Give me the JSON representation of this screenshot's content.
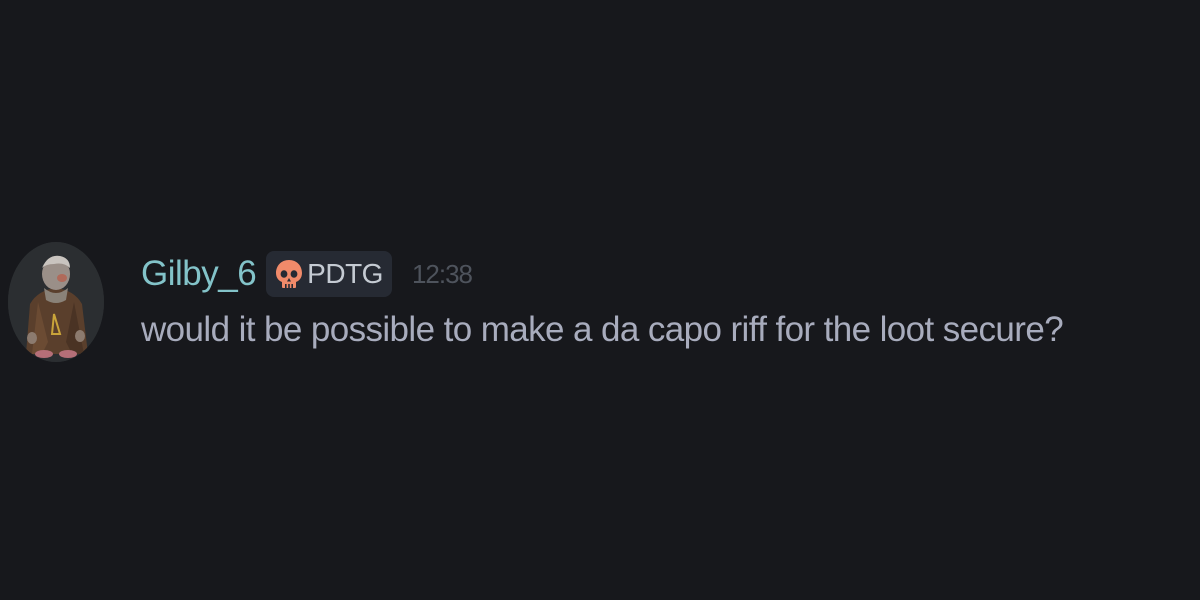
{
  "message": {
    "username": "Gilby_6",
    "tag": {
      "label": "PDTG",
      "icon": "skull-icon"
    },
    "timestamp": "12:38",
    "text": "would it be possible to make a da capo riff for the loot secure?"
  },
  "colors": {
    "background": "#17181c",
    "username": "#83c3c9",
    "tag_background": "#262a33",
    "tag_icon": "#f08a6a",
    "text": "#a8acbd",
    "timestamp": "#4e535c"
  }
}
